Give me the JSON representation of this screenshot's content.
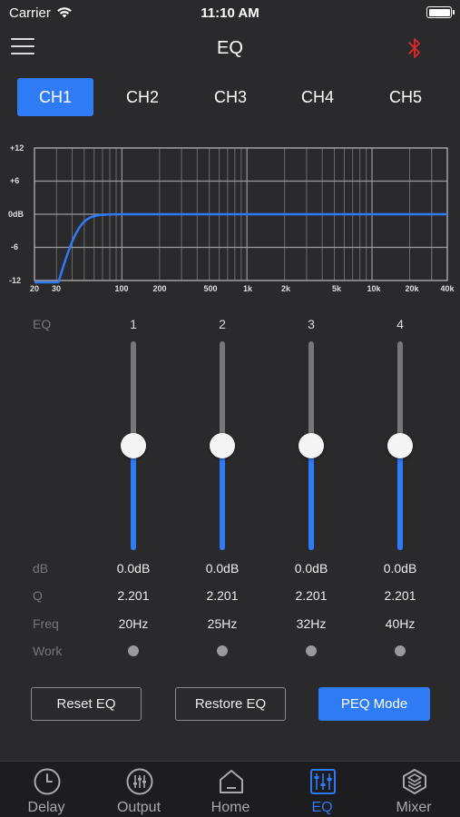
{
  "status": {
    "carrier": "Carrier",
    "time": "11:10 AM"
  },
  "nav": {
    "title": "EQ",
    "menu_icon": "hamburger-menu-icon",
    "bluetooth_icon": "bluetooth-icon",
    "bluetooth_color": "#e0292b"
  },
  "channels": {
    "active_index": 0,
    "tabs": [
      "CH1",
      "CH2",
      "CH3",
      "CH4",
      "CH5"
    ]
  },
  "graph": {
    "y_labels": [
      "+12",
      "+6",
      "0dB",
      "-6",
      "-12"
    ],
    "x_labels": [
      "20",
      "30",
      "100",
      "200",
      "500",
      "1k",
      "2k",
      "5k",
      "10k",
      "20k",
      "40k"
    ],
    "curve_color": "#2f7bf5"
  },
  "bands": {
    "headers": {
      "eq": "EQ",
      "db": "dB",
      "q": "Q",
      "freq": "Freq",
      "work": "Work"
    },
    "items": [
      {
        "number": "1",
        "db": "0.0dB",
        "q": "2.201",
        "freq": "20Hz",
        "gain_db": 0
      },
      {
        "number": "2",
        "db": "0.0dB",
        "q": "2.201",
        "freq": "25Hz",
        "gain_db": 0
      },
      {
        "number": "3",
        "db": "0.0dB",
        "q": "2.201",
        "freq": "32Hz",
        "gain_db": 0
      },
      {
        "number": "4",
        "db": "0.0dB",
        "q": "2.201",
        "freq": "40Hz",
        "gain_db": 0
      }
    ]
  },
  "actions": {
    "reset": "Reset EQ",
    "restore": "Restore EQ",
    "peq_mode": "PEQ Mode"
  },
  "tabbar": {
    "active_index": 3,
    "items": [
      {
        "label": "Delay",
        "icon": "clock-icon"
      },
      {
        "label": "Output",
        "icon": "sliders-icon"
      },
      {
        "label": "Home",
        "icon": "home-icon"
      },
      {
        "label": "EQ",
        "icon": "equalizer-icon"
      },
      {
        "label": "Mixer",
        "icon": "layers-icon"
      }
    ]
  },
  "colors": {
    "accent": "#2f7bf5",
    "background": "#2a2a2c"
  }
}
